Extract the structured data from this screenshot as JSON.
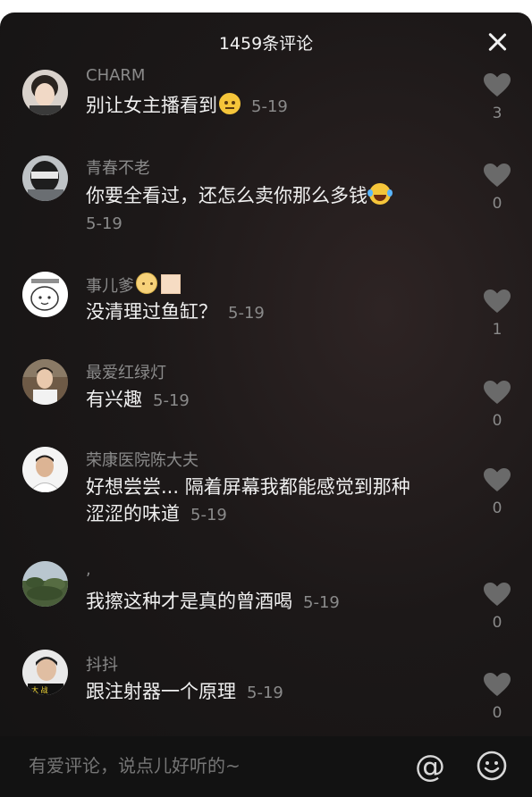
{
  "header": {
    "title": "1459条评论"
  },
  "comments": [
    {
      "username": "CHARM",
      "text": "别让女主播看到",
      "time": "5-19",
      "likes": "3"
    },
    {
      "username": "青春不老",
      "text": "你要全看过，还怎么卖你那么多钱",
      "time": "5-19",
      "likes": "0"
    },
    {
      "username": "事儿爹",
      "text": "没清理过鱼缸？",
      "time": "5-19",
      "likes": "1"
    },
    {
      "username": "最爱红绿灯",
      "text": "有兴趣",
      "time": "5-19",
      "likes": "0"
    },
    {
      "username": "荣康医院陈大夫",
      "text_line1": "好想尝尝... 隔着屏幕我都能感觉到那种",
      "text_line2": "涩涩的味道",
      "time": "5-19",
      "likes": "0"
    },
    {
      "username": ",",
      "text": "我擦这种才是真的曾酒喝",
      "time": "5-19",
      "likes": "0"
    },
    {
      "username": "抖抖",
      "text": "跟注射器一个原理",
      "time": "5-19",
      "likes": "0"
    }
  ],
  "footer": {
    "placeholder": "有爱评论，说点儿好听的~",
    "at_symbol": "@",
    "emoji_icon": "smiley-face-icon"
  },
  "colors": {
    "background": "#1a1717",
    "text": "#f0f0f0",
    "muted": "#8a8a8a"
  }
}
